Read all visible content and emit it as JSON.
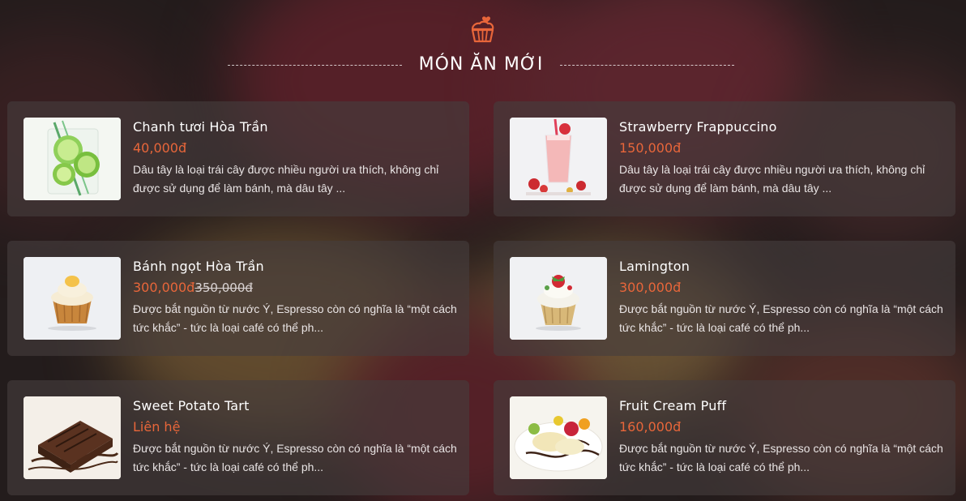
{
  "section": {
    "title": "MÓN ĂN MỚI",
    "icon": "cupcake-heart-icon"
  },
  "colors": {
    "accent": "#e8663a",
    "text": "#ffffff",
    "card_bg": "#463e3e"
  },
  "products": [
    {
      "name": "Chanh tươi Hòa Trần",
      "price": "40,000đ",
      "old_price": "",
      "description": "Dâu tây là loại trái cây được nhiều người ưa thích, không chỉ được sử dụng để làm bánh, mà dâu tây ...",
      "image": "lime-drink-image"
    },
    {
      "name": "Strawberry Frappuccino",
      "price": "150,000đ",
      "old_price": "",
      "description": "Dâu tây là loại trái cây được nhiều người ưa thích, không chỉ được sử dụng để làm bánh, mà dâu tây ...",
      "image": "strawberry-smoothie-image"
    },
    {
      "name": "Bánh ngọt Hòa Trần",
      "price": "300,000đ",
      "old_price": "350,000đ",
      "description": "Được bắt nguồn từ nước Ý, Espresso còn có nghĩa là “một cách tức khắc” - tức là loại café có thể ph...",
      "image": "cupcake-image"
    },
    {
      "name": "Lamington",
      "price": "300,000đ",
      "old_price": "",
      "description": "Được bắt nguồn từ nước Ý, Espresso còn có nghĩa là “một cách tức khắc” - tức là loại café có thể ph...",
      "image": "strawberry-cupcake-image"
    },
    {
      "name": "Sweet Potato Tart",
      "price": "Liên hệ",
      "old_price": "",
      "description": "Được bắt nguồn từ nước Ý, Espresso còn có nghĩa là “một cách tức khắc” - tức là loại café có thể ph...",
      "image": "chocolate-brownie-image"
    },
    {
      "name": "Fruit Cream Puff",
      "price": "160,000đ",
      "old_price": "",
      "description": "Được bắt nguồn từ nước Ý, Espresso còn có nghĩa là “một cách tức khắc” - tức là loại café có thể ph...",
      "image": "fruit-dessert-image"
    }
  ]
}
